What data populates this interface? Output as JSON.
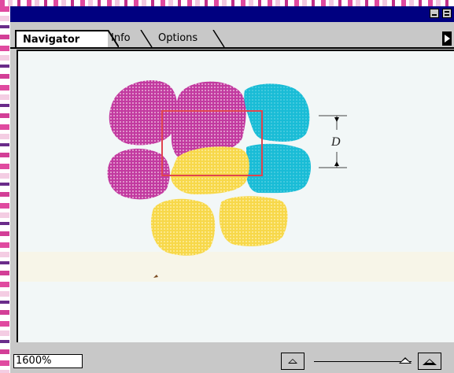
{
  "tabs": [
    {
      "label": "Navigator",
      "active": true
    },
    {
      "label": "Info",
      "active": false
    },
    {
      "label": "Options",
      "active": false
    }
  ],
  "preview": {
    "dimension_label": "D",
    "colors": {
      "magenta": "#c23aa0",
      "yellow": "#f7d84a",
      "cyan": "#19bcd6",
      "view_box": "#e0454f"
    }
  },
  "statusbar": {
    "zoom_value": "1600%",
    "zoom_slider_position": 0.88
  },
  "icons": {
    "minimize": "minimize-icon",
    "close": "close-icon",
    "palette_menu": "palette-menu-arrow-icon",
    "zoom_out": "zoom-out-mountain-icon",
    "zoom_in": "zoom-in-mountain-icon"
  }
}
